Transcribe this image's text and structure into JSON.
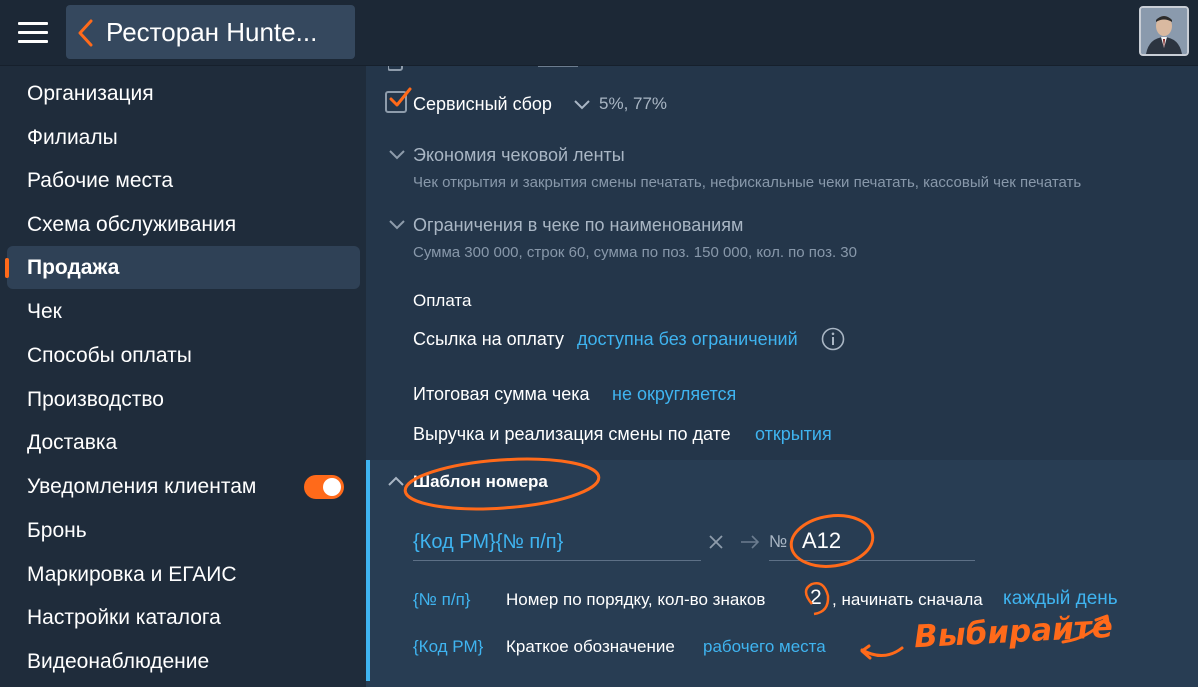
{
  "header": {
    "title": "Ресторан Hunte..."
  },
  "sidebar": {
    "items": [
      {
        "label": "Организация"
      },
      {
        "label": "Филиалы"
      },
      {
        "label": "Рабочие места"
      },
      {
        "label": "Схема обслуживания"
      },
      {
        "label": "Продажа"
      },
      {
        "label": "Чек"
      },
      {
        "label": "Способы оплаты"
      },
      {
        "label": "Производство"
      },
      {
        "label": "Доставка"
      },
      {
        "label": "Уведомления клиентам"
      },
      {
        "label": "Бронь"
      },
      {
        "label": "Маркировка и ЕГАИС"
      },
      {
        "label": "Настройки каталога"
      },
      {
        "label": "Видеонаблюдение"
      }
    ],
    "active_index": 4,
    "notifications_toggle_on": true
  },
  "settings": {
    "service_fee": {
      "label": "Сервисный сбор",
      "value": "5%, 77%",
      "checked": true
    },
    "receipt_economy": {
      "label": "Экономия чековой ленты",
      "summary": "Чек открытия и закрытия смены печатать, нефискальные чеки печатать, кассовый чек печатать"
    },
    "item_limits": {
      "label": "Ограничения в чеке по наименованиям",
      "summary": "Сумма 300 000, строк 60, сумма по поз. 150 000, кол. по поз. 30"
    },
    "payment_heading": "Оплата",
    "payment_link": {
      "label": "Ссылка на оплату",
      "value": "доступна без ограничений"
    },
    "total_rounding": {
      "label": "Итоговая сумма чека",
      "value": "не округляется"
    },
    "revenue_date": {
      "label": "Выручка и реализация смены по дате",
      "value": "открытия"
    }
  },
  "number_template": {
    "title": "Шаблон номера",
    "template_value": "{Код РМ}{№ п/п}",
    "preview_prefix": "№",
    "preview_value": "A12",
    "tokens": [
      {
        "token": "{№ п/п}",
        "text_before": "Номер по порядку, кол-во знаков",
        "digits": "2",
        "text_after": ", начинать сначала",
        "link": "каждый день"
      },
      {
        "token": "{Код РМ}",
        "text_before": "Краткое обозначение",
        "link": "рабочего места"
      }
    ]
  },
  "annotation": {
    "text": "Выбирайте",
    "color": "#ff6a1a"
  },
  "colors": {
    "accent": "#ff6a1a",
    "link": "#3fb4f0",
    "sidebar_bg": "#1f2c3b",
    "content_bg": "#24364a"
  }
}
